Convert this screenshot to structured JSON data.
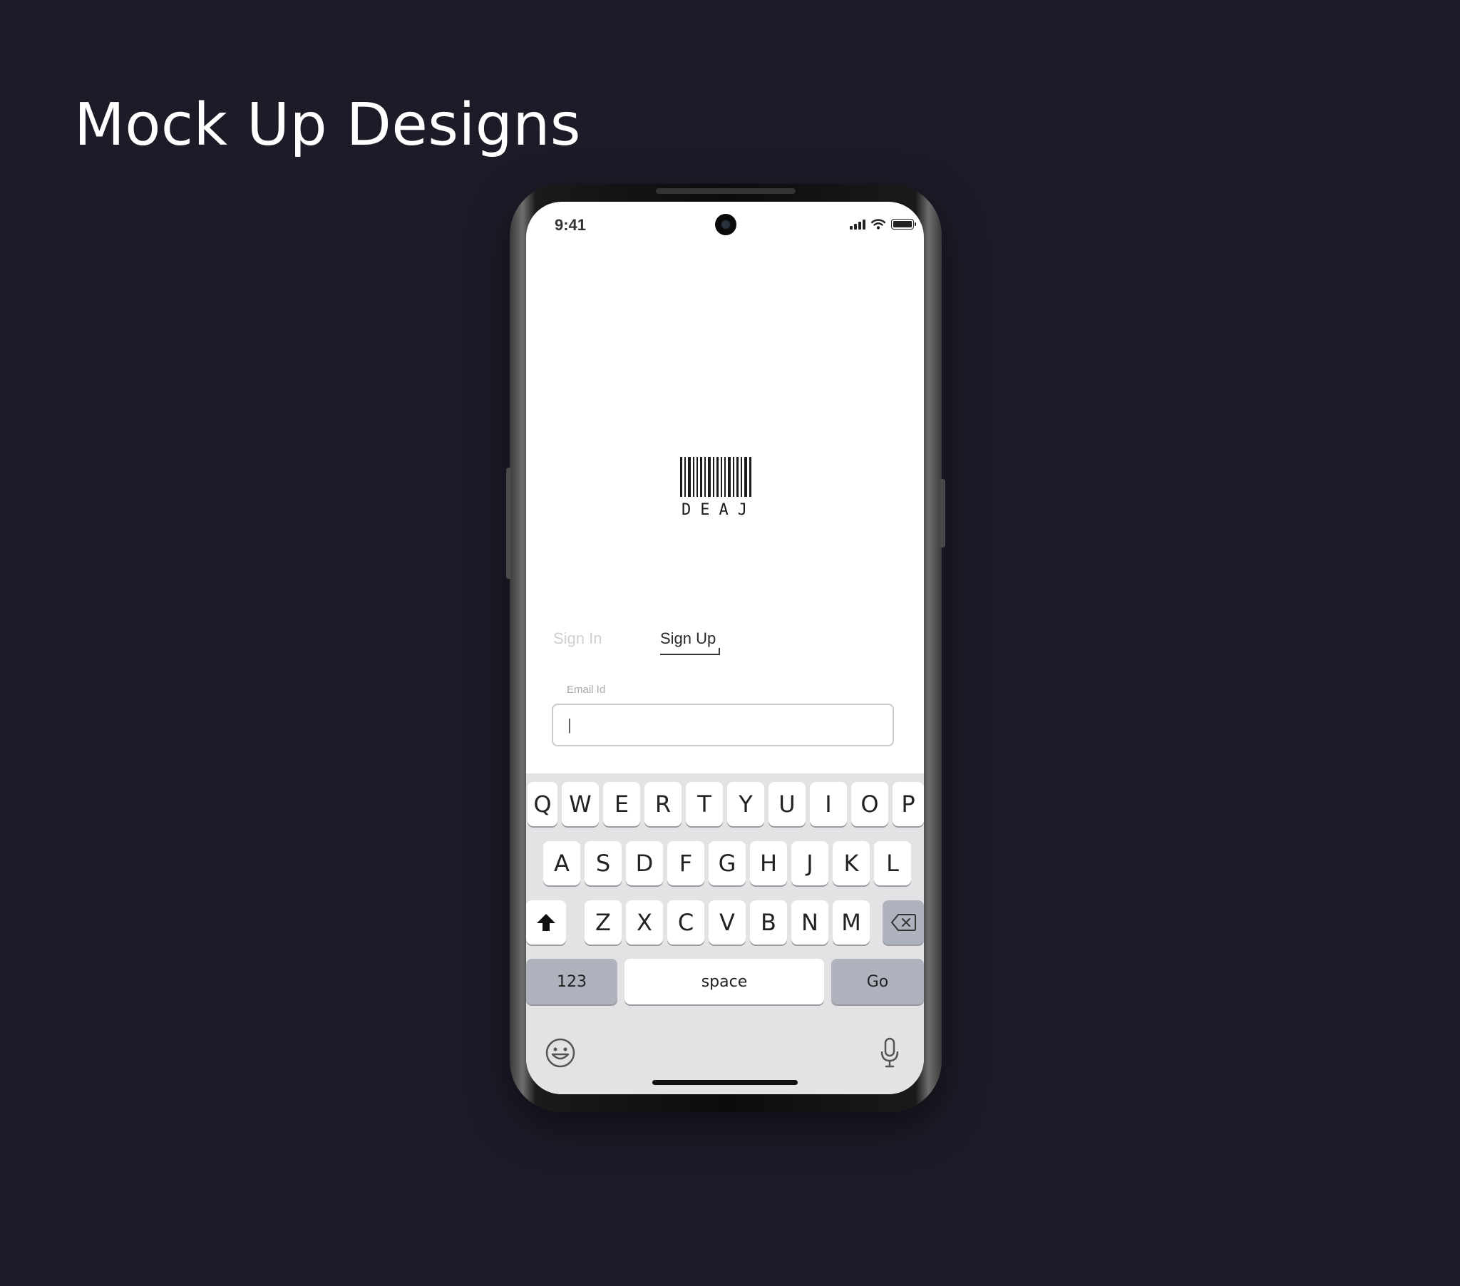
{
  "page": {
    "title": "Mock Up Designs"
  },
  "status_bar": {
    "time": "9:41"
  },
  "logo": {
    "text": "DEAJ"
  },
  "tabs": {
    "sign_in": "Sign In",
    "sign_up": "Sign Up",
    "active": "Sign Up"
  },
  "form": {
    "email_label": "Email Id",
    "email_value": "|"
  },
  "keyboard": {
    "row1": [
      "Q",
      "W",
      "E",
      "R",
      "T",
      "Y",
      "U",
      "I",
      "O",
      "P"
    ],
    "row2": [
      "A",
      "S",
      "D",
      "F",
      "G",
      "H",
      "J",
      "K",
      "L"
    ],
    "row3": [
      "Z",
      "X",
      "C",
      "V",
      "B",
      "N",
      "M"
    ],
    "numbers_label": "123",
    "space_label": "space",
    "go_label": "Go",
    "shift_icon": "shift-arrow-icon",
    "backspace_icon": "backspace-icon",
    "emoji_icon": "emoji-icon",
    "mic_icon": "microphone-icon"
  },
  "colors": {
    "background": "#1d1b28",
    "screen": "#ffffff",
    "keyboard_bg": "#e3e3e6",
    "function_key": "#adb2bc"
  }
}
